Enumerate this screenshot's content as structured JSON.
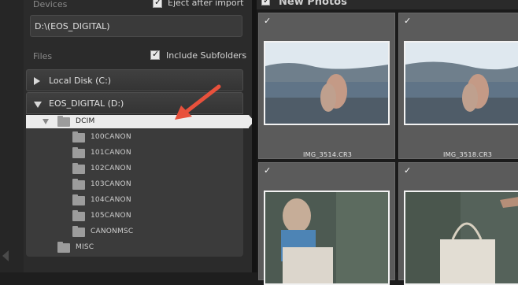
{
  "source": {
    "devices_label": "Devices",
    "eject_label": "Eject after import",
    "path": "D:\\(EOS_DIGITAL)",
    "files_label": "Files",
    "include_sub_label": "Include Subfolders",
    "volumes": [
      {
        "label": "Local Disk (C:)"
      },
      {
        "label": "EOS_DIGITAL (D:)"
      }
    ],
    "tree": {
      "dcim": "DCIM",
      "subfolders": [
        "100CANON",
        "101CANON",
        "102CANON",
        "103CANON",
        "104CANON",
        "105CANON",
        "CANONMSC"
      ],
      "misc": "MISC"
    }
  },
  "grid": {
    "title": "New Photos",
    "photos": [
      {
        "filename": "IMG_3514.CR3"
      },
      {
        "filename": "IMG_3518.CR3"
      },
      {
        "filename": ""
      },
      {
        "filename": ""
      }
    ]
  },
  "colors": {
    "panel_bg": "#2b2b2b",
    "selected_row": "#ececec",
    "annotation_arrow": "#e8513c"
  }
}
